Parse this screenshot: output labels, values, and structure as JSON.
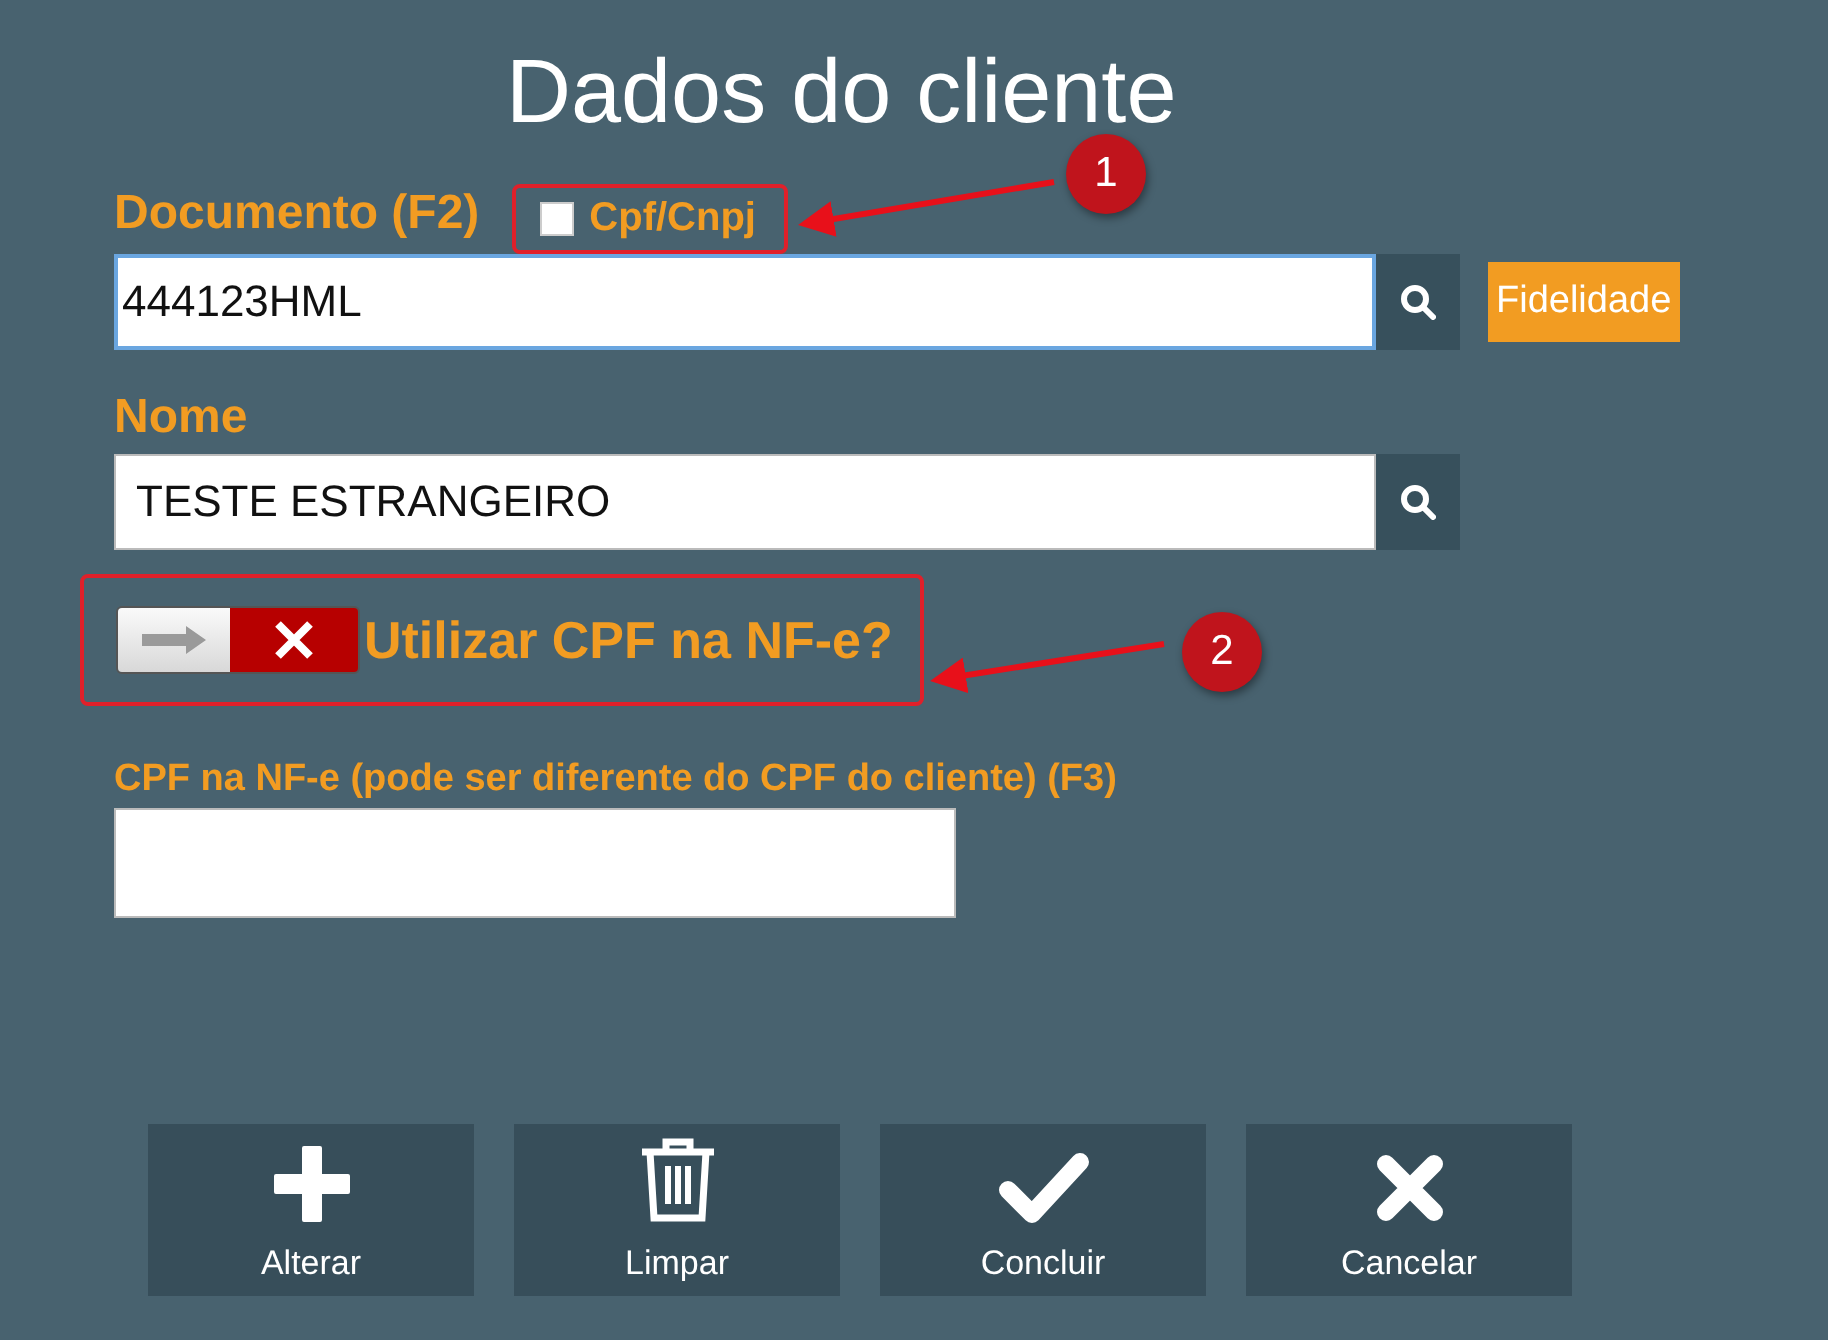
{
  "title": "Dados do cliente",
  "documento": {
    "label": "Documento (F2)",
    "checkbox": {
      "label": "Cpf/Cnpj",
      "checked": false
    },
    "value": "444123HML",
    "fidelidade_button": "Fidelidade"
  },
  "nome": {
    "label": "Nome",
    "value": "TESTE ESTRANGEIRO"
  },
  "cpf_toggle": {
    "label": "Utilizar CPF na NF-e?",
    "on": false
  },
  "cpf_nfe": {
    "label": "CPF na NF-e (pode ser diferente do CPF do cliente) (F3)"
  },
  "annotations": [
    "1",
    "2"
  ],
  "buttons": [
    {
      "kind": "add",
      "label": "Alterar"
    },
    {
      "kind": "trash",
      "label": "Limpar"
    },
    {
      "kind": "check",
      "label": "Concluir"
    },
    {
      "kind": "cross",
      "label": "Cancelar"
    }
  ]
}
